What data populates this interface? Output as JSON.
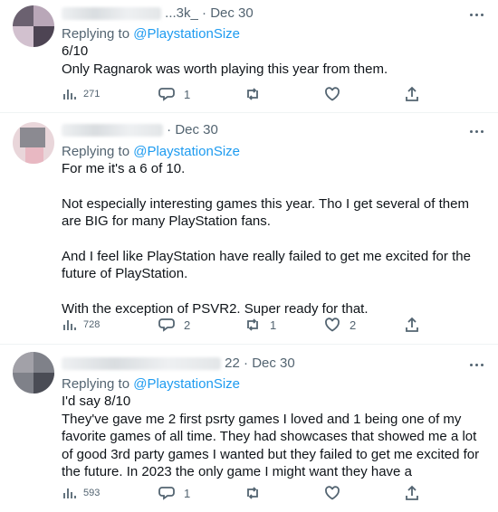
{
  "tweets": [
    {
      "author_fragment": "...3k_",
      "date": "Dec 30",
      "replying_prefix": "Replying to ",
      "replying_to": "@PlaystationSize",
      "paragraphs": [
        "6/10",
        "Only Ragnarok was worth playing this year from them."
      ],
      "views": "271",
      "replies": "1",
      "retweets": "",
      "likes": ""
    },
    {
      "author_fragment": "",
      "date": "Dec 30",
      "replying_prefix": "Replying to ",
      "replying_to": "@PlaystationSize",
      "paragraphs": [
        "For me it's a 6 of 10.",
        "Not especially interesting games this year. Tho I get several of them are BIG for many PlayStation fans.",
        "And I feel like PlayStation have really failed to get me excited for the future of PlayStation.",
        "With the exception of PSVR2. Super ready for that."
      ],
      "views": "728",
      "replies": "2",
      "retweets": "1",
      "likes": "2"
    },
    {
      "author_fragment": "22",
      "date": "Dec 30",
      "replying_prefix": "Replying to ",
      "replying_to": "@PlaystationSize",
      "paragraphs": [
        "I'd say 8/10",
        "They've gave me 2 first psrty games I loved and 1 being one of my favorite games of all time. They had showcases that showed me a lot of good 3rd party games I wanted but they failed to get me excited for the future. In 2023 the only game I might want they have a"
      ],
      "views": "593",
      "replies": "1",
      "retweets": "",
      "likes": ""
    }
  ],
  "icons": {
    "views": "bar-chart-icon",
    "reply": "speech-bubble-icon",
    "retweet": "retweet-arrows-icon",
    "like": "heart-icon",
    "share": "share-upload-icon",
    "more": "more-horizontal-icon"
  },
  "colors": {
    "mention": "#1d9bf0",
    "secondary_text": "#536471",
    "primary_text": "#0f1419",
    "divider": "#eff3f4"
  }
}
